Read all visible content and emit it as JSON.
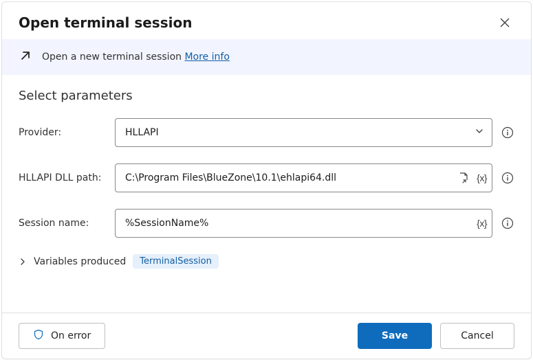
{
  "title": "Open terminal session",
  "banner": {
    "text": "Open a new terminal session",
    "link": "More info"
  },
  "section_title": "Select parameters",
  "fields": {
    "provider": {
      "label": "Provider:",
      "value": "HLLAPI"
    },
    "dllpath": {
      "label": "HLLAPI DLL path:",
      "value": "C:\\Program Files\\BlueZone\\10.1\\ehlapi64.dll"
    },
    "session": {
      "label": "Session name:",
      "value": "%SessionName%"
    }
  },
  "vars": {
    "label": "Variables produced",
    "chip": "TerminalSession"
  },
  "footer": {
    "onerror": "On error",
    "save": "Save",
    "cancel": "Cancel"
  }
}
